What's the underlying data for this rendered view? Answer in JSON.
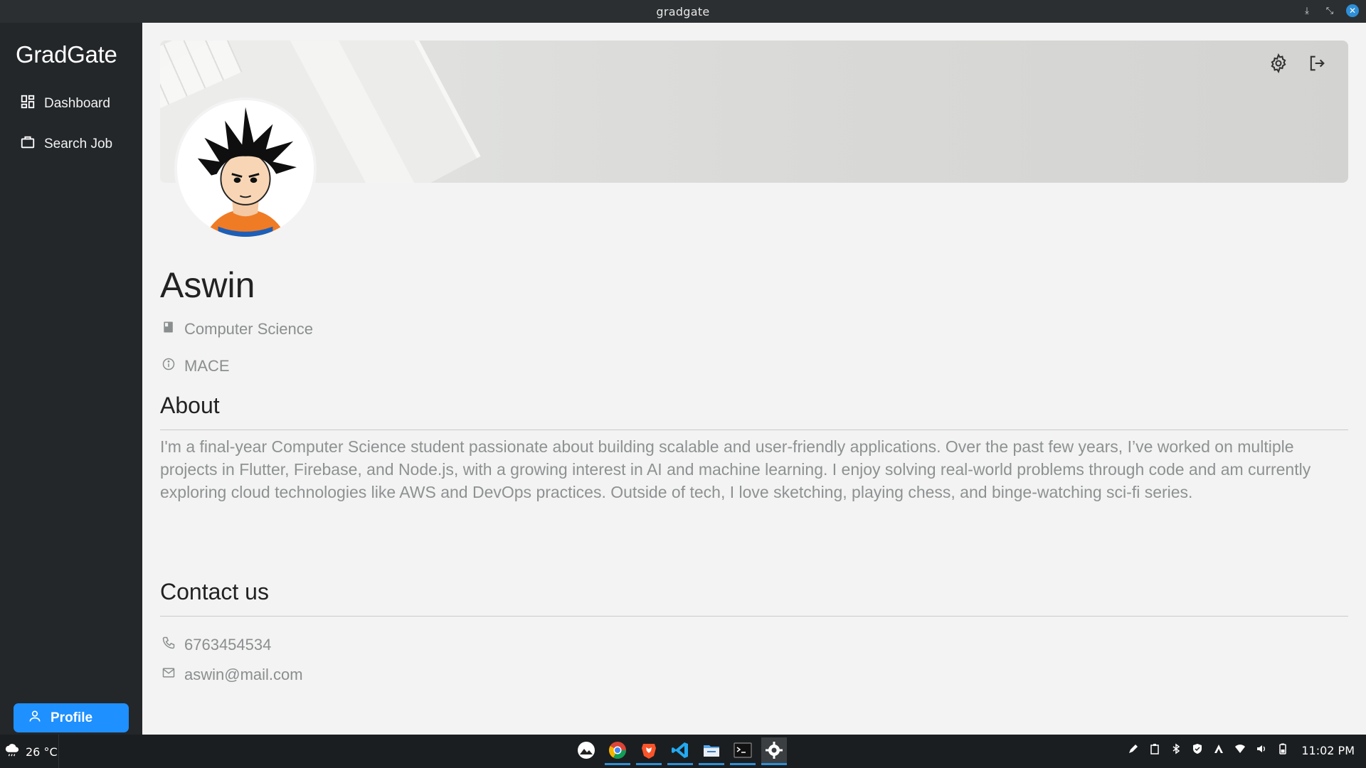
{
  "window": {
    "title": "gradgate"
  },
  "sidebar": {
    "logo": "GradGate",
    "items": [
      {
        "label": "Dashboard",
        "icon": "dashboard-icon"
      },
      {
        "label": "Search Job",
        "icon": "briefcase-icon"
      }
    ],
    "profile_button": {
      "label": "Profile",
      "icon": "user-icon"
    }
  },
  "profile": {
    "name": "Aswin",
    "department": "Computer Science",
    "college": "MACE",
    "about_title": "About",
    "about_text": "I'm a final-year Computer Science student passionate about building scalable and user-friendly applications. Over the past few years, I’ve worked on multiple projects in Flutter, Firebase, and Node.js, with a growing interest in AI and machine learning. I enjoy solving real-world problems through code and am currently exploring cloud technologies like AWS and DevOps practices. Outside of tech, I love sketching, playing chess, and binge-watching sci-fi series.",
    "contact_title": "Contact us",
    "phone": "6763454534",
    "email": "aswin@mail.com"
  },
  "taskbar": {
    "weather": "26 °C",
    "clock": "11:02 PM",
    "apps": [
      "mountain-app-icon",
      "chrome-icon",
      "brave-icon",
      "vscode-icon",
      "files-icon",
      "terminal-icon",
      "settings-app-icon"
    ]
  },
  "colors": {
    "accent": "#1e90ff",
    "sidebar_bg": "#23272a",
    "content_bg": "#f2f3f2",
    "muted_text": "#8b8e8f"
  }
}
